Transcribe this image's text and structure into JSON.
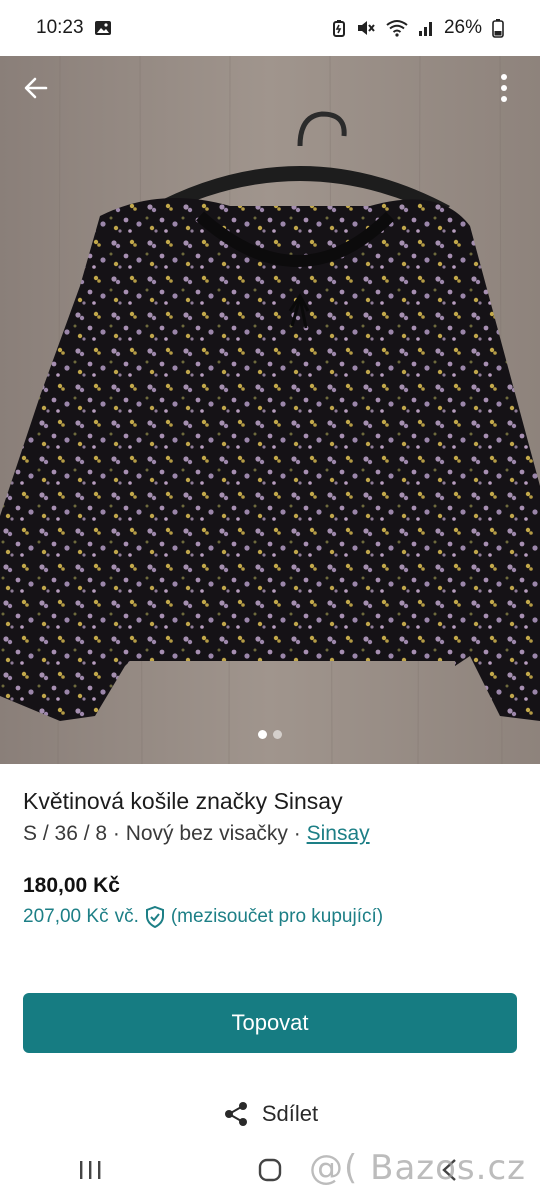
{
  "status_bar": {
    "time": "10:23",
    "battery": "26%"
  },
  "gallery": {
    "back_icon": "arrow-left-icon",
    "more_icon": "more-vertical-icon",
    "page_count": 2,
    "active_page": 1
  },
  "listing": {
    "title": "Květinová košile značky Sinsay",
    "meta_prefix": "S / 36 / 8 · Nový bez visačky · ",
    "brand": "Sinsay",
    "price": "180,00 Kč",
    "buyer_price": "207,00 Kč",
    "buyer_price_suffix": "vč.",
    "buyer_price_note": "(mezisoučet pro kupující)"
  },
  "actions": {
    "promote_label": "Topovat",
    "share_label": "Sdílet"
  },
  "watermark": "@( Bazos.cz",
  "colors": {
    "accent": "#167c82",
    "link": "#1d7f86"
  }
}
